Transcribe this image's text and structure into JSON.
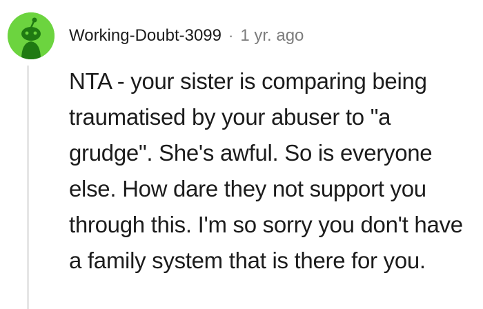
{
  "comment": {
    "author": "Working-Doubt-3099",
    "separator": "·",
    "timestamp": "1 yr. ago",
    "avatar_icon": "snoo-avatar-icon",
    "body": "NTA - your sister is comparing being traumatised by your abuser to \"a grudge\". She's awful. So is everyone else. How dare they not support you through this. I'm so sorry you don't have a family system that is there for you."
  },
  "colors": {
    "avatar_background": "#6cd43f",
    "text": "#1c1c1c",
    "meta_text": "#7c7c7c",
    "thread_line": "#e6e6e6"
  }
}
